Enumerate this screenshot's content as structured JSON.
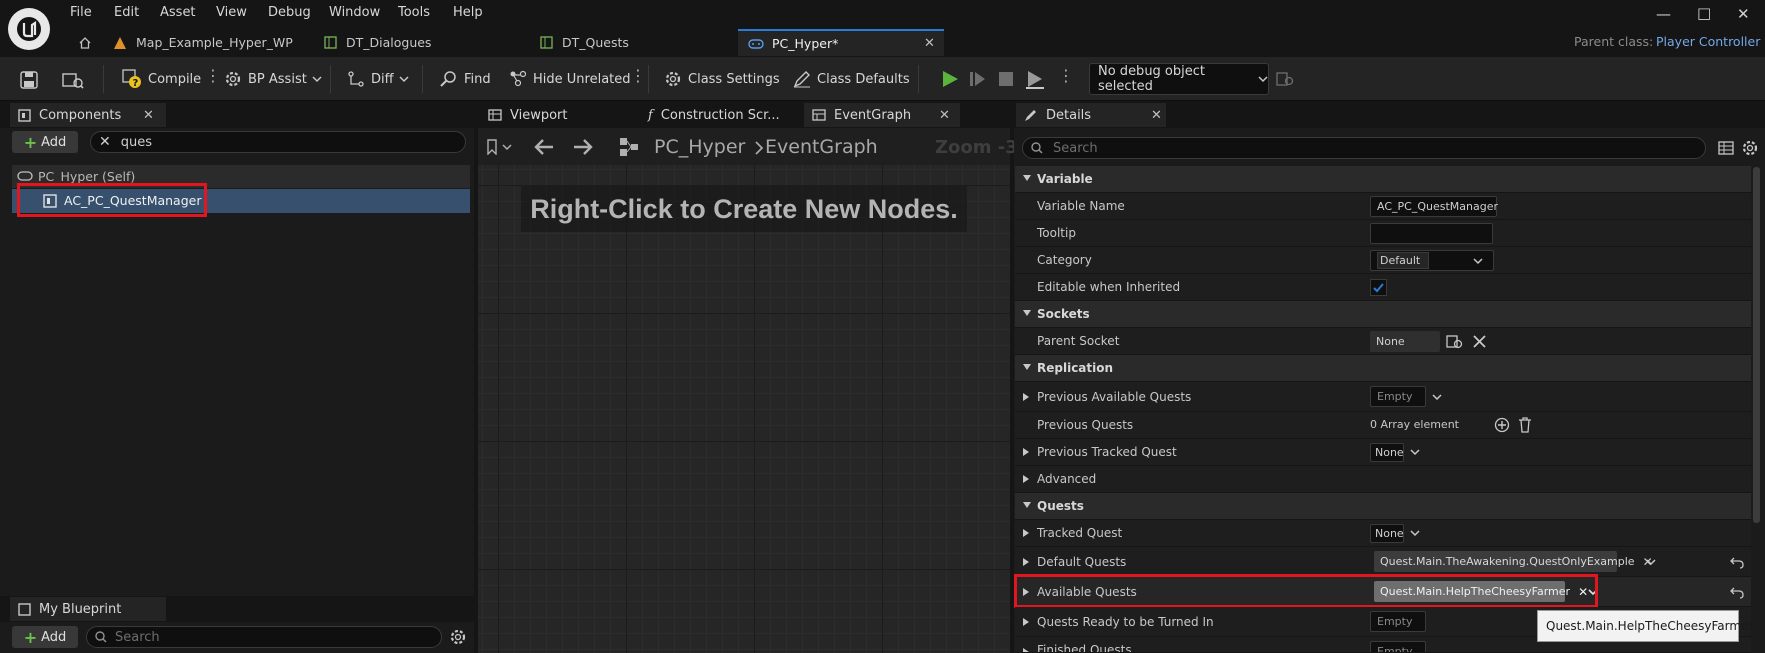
{
  "menu": [
    "File",
    "Edit",
    "Asset",
    "View",
    "Debug",
    "Window",
    "Tools",
    "Help"
  ],
  "tabs": [
    {
      "label": "Map_Example_Hyper_WP"
    },
    {
      "label": "DT_Dialogues"
    },
    {
      "label": "DT_Quests"
    },
    {
      "label": "PC_Hyper*"
    }
  ],
  "parent_class": {
    "label": "Parent class:",
    "value": "Player Controller"
  },
  "toolbar": {
    "compile": "Compile",
    "bp_assist": "BP Assist",
    "diff": "Diff",
    "find": "Find",
    "hide_unrelated": "Hide Unrelated",
    "class_settings": "Class Settings",
    "class_defaults": "Class Defaults",
    "debug_object": "No debug object selected"
  },
  "components": {
    "tab_label": "Components",
    "add_label": "Add",
    "search_value": "ques",
    "items": [
      {
        "label": "PC_Hyper (Self)"
      },
      {
        "label": "AC_PC_QuestManager"
      }
    ]
  },
  "my_blueprint": {
    "tab_label": "My Blueprint",
    "add_label": "Add",
    "search_placeholder": "Search"
  },
  "graph": {
    "tabs": [
      "Viewport",
      "Construction Scr...",
      "EventGraph"
    ],
    "breadcrumb_root": "PC_Hyper",
    "breadcrumb_leaf": "EventGraph",
    "zoom": "Zoom -3",
    "hint": "Right-Click to Create New Nodes."
  },
  "details": {
    "tab_label": "Details",
    "search_placeholder": "Search",
    "variable": {
      "category": "Variable",
      "variable_name_label": "Variable Name",
      "variable_name_value": "AC_PC_QuestManager",
      "tooltip_label": "Tooltip",
      "category_label": "Category",
      "category_value": "Default",
      "editable_label": "Editable when Inherited",
      "editable_checked": true
    },
    "sockets": {
      "category": "Sockets",
      "parent_socket_label": "Parent Socket",
      "parent_socket_value": "None"
    },
    "replication": {
      "category": "Replication",
      "prev_available_label": "Previous Available Quests",
      "prev_available_value": "Empty",
      "prev_quests_label": "Previous Quests",
      "prev_quests_value": "0 Array element",
      "prev_tracked_label": "Previous Tracked Quest",
      "prev_tracked_value": "None",
      "advanced_label": "Advanced"
    },
    "quests": {
      "category": "Quests",
      "tracked_label": "Tracked Quest",
      "tracked_value": "None",
      "default_label": "Default Quests",
      "default_value": "Quest.Main.TheAwakening.QuestOnlyExample",
      "available_label": "Available Quests",
      "available_value": "Quest.Main.HelpTheCheesyFarmer",
      "ready_label": "Quests Ready to be Turned In",
      "ready_value": "Empty",
      "finished_label": "Finished Quests",
      "finished_value": "Empty"
    }
  },
  "tooltip": "Quest.Main.HelpTheCheesyFarmer",
  "colors": {
    "accent": "#2b7ad8",
    "highlight": "#e1161e",
    "play": "#5ab43c"
  }
}
